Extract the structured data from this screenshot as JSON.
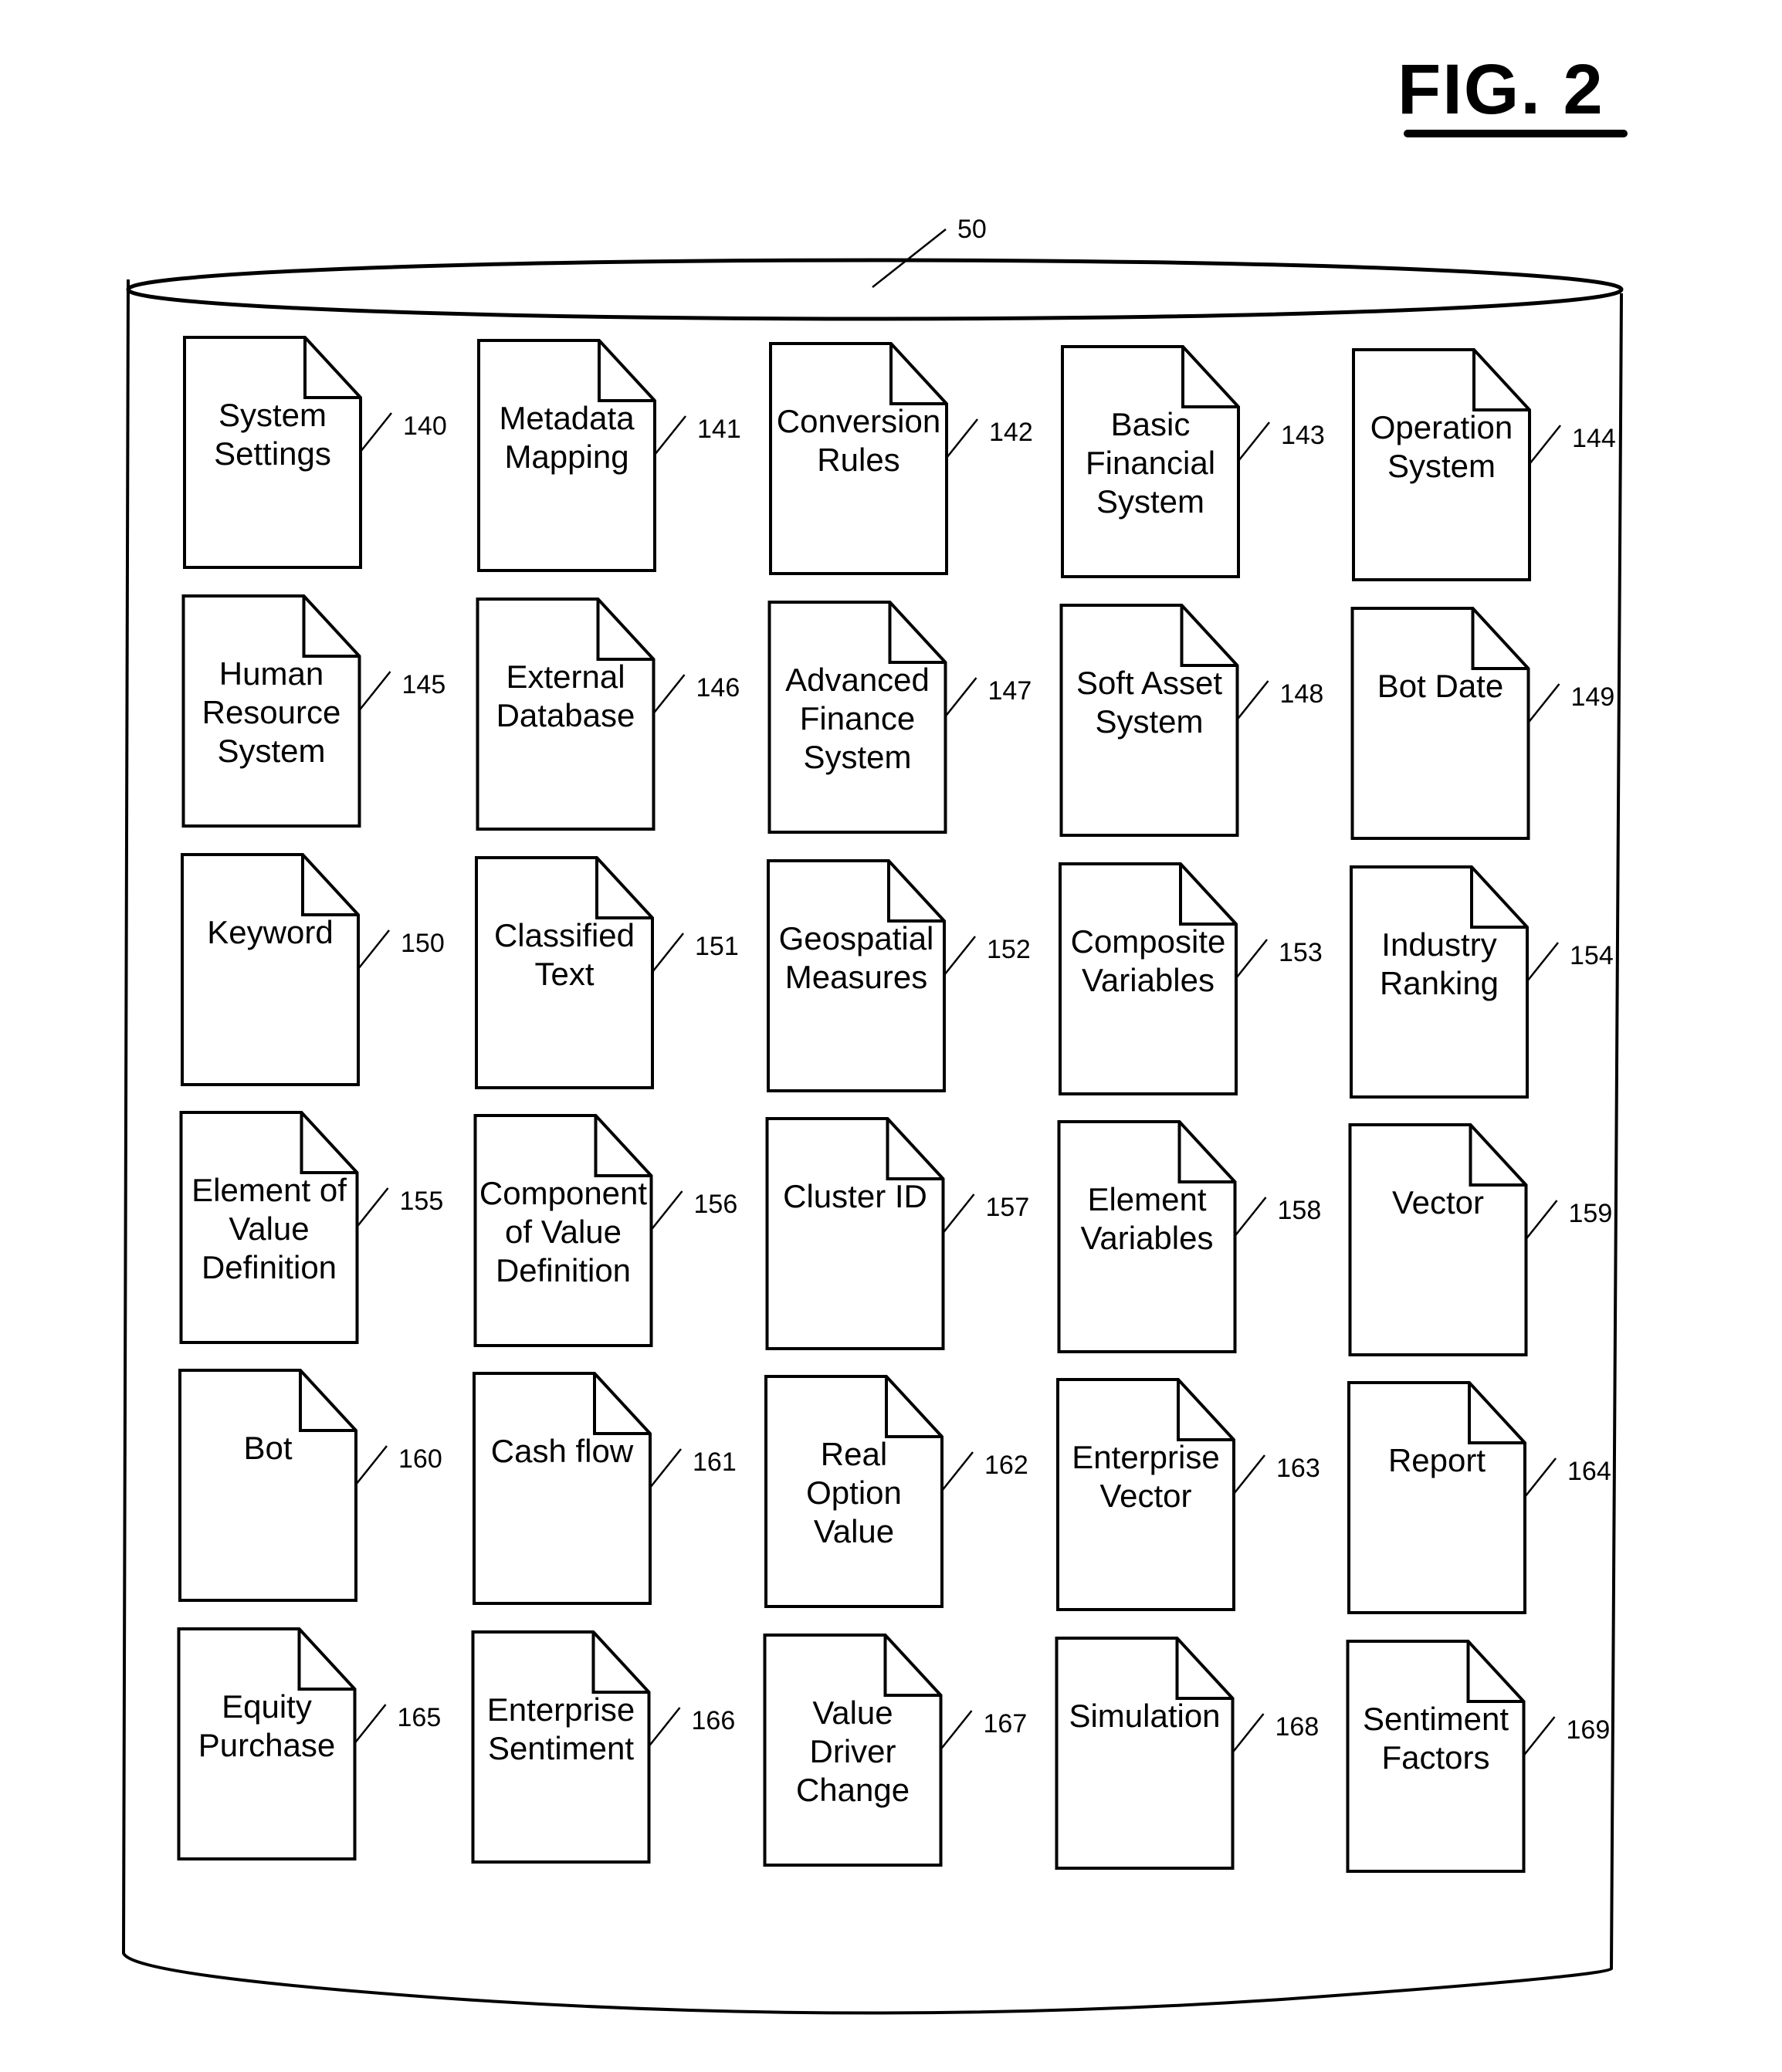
{
  "figure": {
    "title": "FIG. 2",
    "container_ref": "50"
  },
  "documents": [
    {
      "lines": [
        "System",
        "Settings"
      ],
      "ref": "140"
    },
    {
      "lines": [
        "Metadata",
        "Mapping"
      ],
      "ref": "141"
    },
    {
      "lines": [
        "Conversion",
        "Rules"
      ],
      "ref": "142"
    },
    {
      "lines": [
        "Basic",
        "Financial",
        "System"
      ],
      "ref": "143"
    },
    {
      "lines": [
        "Operation",
        "System"
      ],
      "ref": "144"
    },
    {
      "lines": [
        "Human",
        "Resource",
        "System"
      ],
      "ref": "145"
    },
    {
      "lines": [
        "External",
        "Database"
      ],
      "ref": "146"
    },
    {
      "lines": [
        "Advanced",
        "Finance",
        "System"
      ],
      "ref": "147"
    },
    {
      "lines": [
        "Soft Asset",
        "System"
      ],
      "ref": "148"
    },
    {
      "lines": [
        "Bot Date"
      ],
      "ref": "149"
    },
    {
      "lines": [
        "Keyword"
      ],
      "ref": "150"
    },
    {
      "lines": [
        "Classified",
        "Text"
      ],
      "ref": "151"
    },
    {
      "lines": [
        "Geospatial",
        "Measures"
      ],
      "ref": "152"
    },
    {
      "lines": [
        "Composite",
        "Variables"
      ],
      "ref": "153"
    },
    {
      "lines": [
        "Industry",
        "Ranking"
      ],
      "ref": "154"
    },
    {
      "lines": [
        "Element of",
        "Value",
        "Definition"
      ],
      "ref": "155"
    },
    {
      "lines": [
        "Component",
        "of Value",
        "Definition"
      ],
      "ref": "156"
    },
    {
      "lines": [
        "Cluster ID"
      ],
      "ref": "157"
    },
    {
      "lines": [
        "Element",
        "Variables"
      ],
      "ref": "158"
    },
    {
      "lines": [
        "Vector"
      ],
      "ref": "159"
    },
    {
      "lines": [
        "Bot"
      ],
      "ref": "160"
    },
    {
      "lines": [
        "Cash flow"
      ],
      "ref": "161"
    },
    {
      "lines": [
        "Real",
        "Option",
        "Value"
      ],
      "ref": "162"
    },
    {
      "lines": [
        "Enterprise",
        "Vector"
      ],
      "ref": "163"
    },
    {
      "lines": [
        "Report"
      ],
      "ref": "164"
    },
    {
      "lines": [
        "Equity",
        "Purchase"
      ],
      "ref": "165"
    },
    {
      "lines": [
        "Enterprise",
        "Sentiment"
      ],
      "ref": "166"
    },
    {
      "lines": [
        "Value",
        "Driver",
        "Change"
      ],
      "ref": "167"
    },
    {
      "lines": [
        "Simulation"
      ],
      "ref": "168"
    },
    {
      "lines": [
        "Sentiment",
        "Factors"
      ],
      "ref": "169"
    }
  ]
}
